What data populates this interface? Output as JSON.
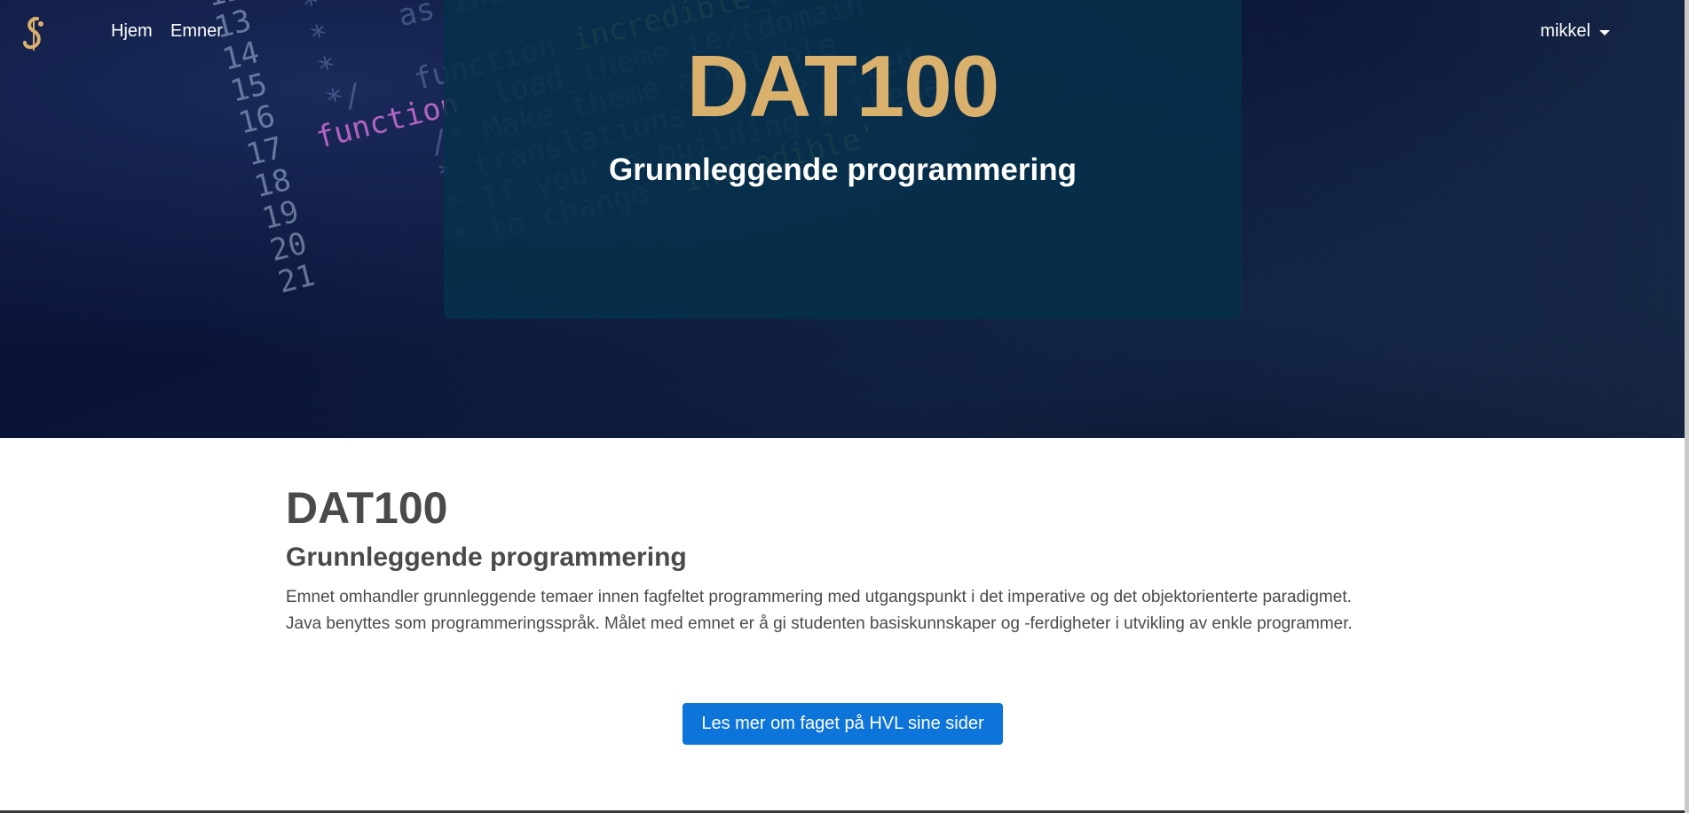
{
  "navbar": {
    "logo_name": "hvl-logo",
    "links": [
      {
        "label": "Hjem"
      },
      {
        "label": "Emner"
      }
    ],
    "user": {
      "name": "mikkel"
    }
  },
  "hero": {
    "title": "DAT100",
    "subtitle": "Grunnleggende programmering"
  },
  "course": {
    "code": "DAT100",
    "name": "Grunnleggende programmering",
    "description": "Emnet omhandler grunnleggende temaer innen fagfeltet programmering med utgangspunkt i det imperative og det objektorienterte paradigmet. Java benyttes som programmeringsspråk. Målet med emnet er å gi studenten basiskunnskaper og -ferdigheter i utvikling av enkle programmer.",
    "more_button": "Les mer om faget på HVL sine sider"
  },
  "colors": {
    "accent_gold": "#d9b06c",
    "card_bg": "#06304a",
    "button_blue": "#0d74d9",
    "text_dark": "#4a4a4a"
  }
}
